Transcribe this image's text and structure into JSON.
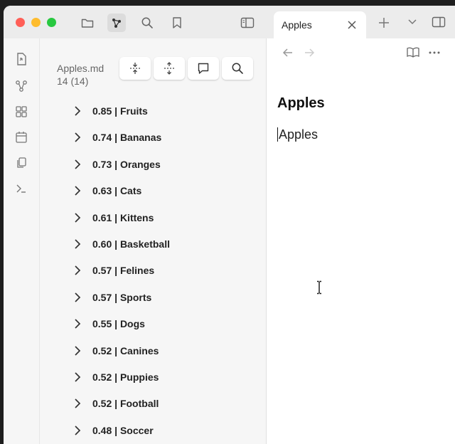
{
  "window": {
    "traffic_lights": [
      {
        "name": "close",
        "color": "#ff5f57"
      },
      {
        "name": "minimize",
        "color": "#febc2e"
      },
      {
        "name": "zoom",
        "color": "#28c840"
      }
    ]
  },
  "titlebar_icons": [
    "folder-icon",
    "graph-icon",
    "search-icon",
    "bookmark-icon",
    "sidebar-toggle-icon"
  ],
  "ribbon_icons": [
    "open-file-icon",
    "graph-view-icon",
    "canvas-icon",
    "calendar-icon",
    "copy-icon",
    "terminal-icon"
  ],
  "sidepane": {
    "file_name": "Apples.md",
    "count": "14 (14)",
    "tools": [
      "collapse-all-icon",
      "expand-all-icon",
      "comment-icon",
      "search-icon"
    ],
    "results": [
      {
        "label": "0.85 | Fruits"
      },
      {
        "label": "0.74 | Bananas"
      },
      {
        "label": "0.73 | Oranges"
      },
      {
        "label": "0.63 | Cats"
      },
      {
        "label": "0.61 | Kittens"
      },
      {
        "label": "0.60 | Basketball"
      },
      {
        "label": "0.57 | Felines"
      },
      {
        "label": "0.57 | Sports"
      },
      {
        "label": "0.55 | Dogs"
      },
      {
        "label": "0.52 | Canines"
      },
      {
        "label": "0.52 | Puppies"
      },
      {
        "label": "0.52 | Football"
      },
      {
        "label": "0.48 | Soccer"
      }
    ]
  },
  "tab": {
    "label": "Apples"
  },
  "editor": {
    "title": "Apples",
    "body": "Apples"
  },
  "colors": {
    "accent": "#7b6cd9",
    "background": "#f6f6f6",
    "editor": "#ffffff"
  }
}
